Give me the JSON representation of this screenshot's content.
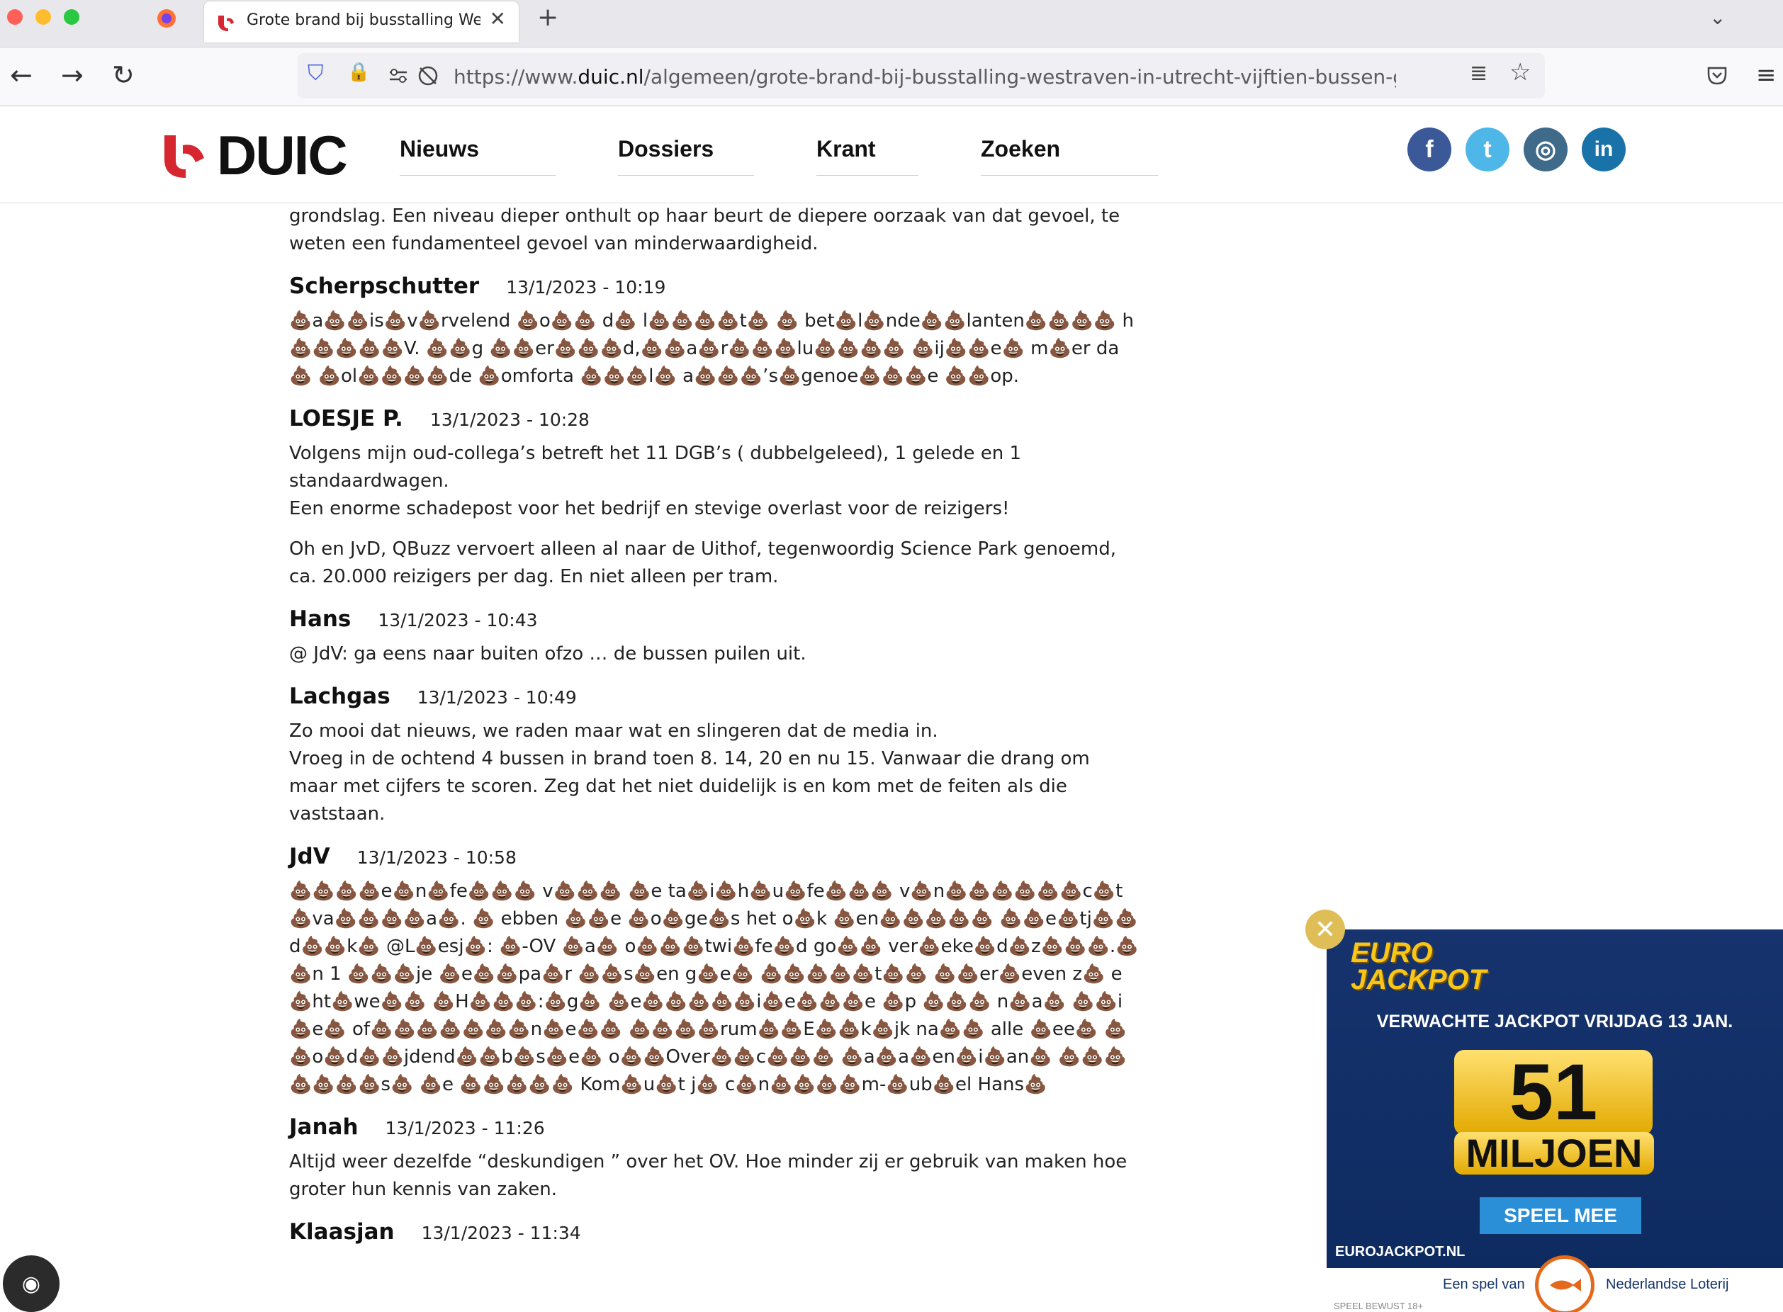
{
  "browser": {
    "tab_title": "Grote brand bij busstalling West",
    "tab_close": "✕",
    "new_tab": "+",
    "url_prefix": "https://www.",
    "url_domain": "duic.nl",
    "url_path": "/algemeen/grote-brand-bij-busstalling-westraven-in-utrecht-vijftien-bussen-getroffen-mee",
    "icons": {
      "back": "←",
      "forward": "→",
      "reload": "↻",
      "shield": "⛉",
      "lock": "🔒",
      "reader": "≣",
      "bookmark": "☆",
      "pocket": "⛉",
      "menu": "≡",
      "tab_list": "⌄"
    }
  },
  "site": {
    "logo_text": "DUIC",
    "brand_color": "#d6262f",
    "menu": [
      "Nieuws",
      "Dossiers",
      "Krant",
      "Zoeken"
    ],
    "social": [
      {
        "name": "facebook",
        "glyph": "f",
        "color": "#3b5998"
      },
      {
        "name": "twitter",
        "glyph": "t",
        "color": "#4fb6e8"
      },
      {
        "name": "instagram",
        "glyph": "◎",
        "color": "#3f6a8a"
      },
      {
        "name": "linkedin",
        "glyph": "in",
        "color": "#1a73a8"
      }
    ]
  },
  "intro_text": "grondslag. Een niveau dieper onthult op haar beurt de diepere oorzaak van dat gevoel, te weten een fundamenteel gevoel van minderwaardigheid.",
  "comments": [
    {
      "author": "Scherpschutter",
      "date": "13/1/2023 - 10:19",
      "paragraphs": [
        "💩a💩💩is💩v💩rvelend 💩o💩💩 d💩 l💩💩💩💩t💩 💩 bet💩l💩nde💩💩lanten💩💩💩💩 h💩💩💩💩💩V. 💩💩g 💩💩er💩💩💩d,💩💩a💩r💩💩💩lu💩💩💩💩 💩ij💩💩e💩 m💩er da💩 💩ol💩💩💩💩de 💩omforta 💩💩💩l💩 a💩💩💩’s💩genoe💩💩💩e 💩💩op."
      ]
    },
    {
      "author": "LOESJE P.",
      "date": "13/1/2023 - 10:28",
      "paragraphs": [
        "Volgens mijn oud-collega’s betreft het 11 DGB’s ( dubbelgeleed), 1 gelede en 1 standaardwagen.\nEen enorme schadepost voor het bedrijf en stevige overlast voor de reizigers!",
        "Oh en JvD, QBuzz vervoert alleen al naar de Uithof, tegenwoordig Science Park genoemd, ca. 20.000 reizigers per dag. En niet alleen per tram."
      ]
    },
    {
      "author": "Hans",
      "date": "13/1/2023 - 10:43",
      "paragraphs": [
        "@ JdV: ga eens naar buiten ofzo … de bussen puilen uit."
      ]
    },
    {
      "author": "Lachgas",
      "date": "13/1/2023 - 10:49",
      "paragraphs": [
        "Zo mooi dat nieuws, we raden maar wat en slingeren dat de media in.\nVroeg in de ochtend 4 bussen in brand toen 8. 14, 20 en nu 15. Vanwaar die drang om maar met cijfers te scoren. Zeg dat het niet duidelijk is en kom met de feiten als die vaststaan."
      ]
    },
    {
      "author": "JdV",
      "date": "13/1/2023 - 10:58",
      "paragraphs": [
        "💩💩💩💩e💩n💩fe💩💩💩 v💩💩💩 💩e ta💩i💩h💩u💩fe💩💩💩 v💩n💩💩💩💩💩💩c💩t💩va💩💩💩💩a💩. 💩 ebben 💩💩e 💩o💩ge💩s het o💩k 💩en💩💩💩💩💩 💩💩e💩tj💩💩d💩💩k💩 @L💩esj💩: 💩-OV 💩a💩 o💩💩💩twi💩fe💩d go💩💩 ver💩eke💩d💩z💩💩💩.💩💩n 1 💩💩💩je 💩e💩💩pa💩r 💩💩s💩en g💩e💩 💩💩💩💩💩t💩💩 💩💩er💩even z💩 e💩ht💩we💩💩 💩H💩💩💩:💩g💩 💩e💩💩💩💩💩i💩e💩💩💩e 💩p 💩💩💩 n💩a💩 💩💩i💩e💩 of💩💩💩💩💩💩💩n💩e💩💩 💩💩💩💩rum💩💩E💩💩k💩jk na💩💩 alle 💩ee💩 💩💩o💩d💩💩jdend💩💩b💩s💩e💩 o💩💩Over💩💩c💩💩💩 💩a💩a💩en💩i💩an💩 💩💩💩💩💩💩💩s💩 💩e 💩💩💩💩💩 Kom💩u💩t j💩 c💩n💩💩💩💩m-💩ub💩el Hans💩"
      ]
    },
    {
      "author": "Janah",
      "date": "13/1/2023 - 11:26",
      "paragraphs": [
        "Altijd weer dezelfde “deskundigen ” over het OV. Hoe minder zij er gebruik van maken hoe groter hun kennis van zaken."
      ]
    },
    {
      "author": "Klaasjan",
      "date": "13/1/2023 - 11:34",
      "paragraphs": []
    }
  ],
  "ad": {
    "close_glyph": "✕",
    "logo_line1": "EURO",
    "logo_line2": "JACKPOT",
    "headline": "VERWACHTE JACKPOT VRIJDAG 13 JAN.",
    "amount": "51",
    "unit": "MILJOEN",
    "cta": "SPEEL MEE",
    "site": "EUROJACKPOT.NL",
    "footer_left": "Een spel van",
    "footer_right": "Nederlandse Loterij",
    "footer_small": "SPEEL BEWUST 18+"
  },
  "fingerprint_glyph": "◉"
}
